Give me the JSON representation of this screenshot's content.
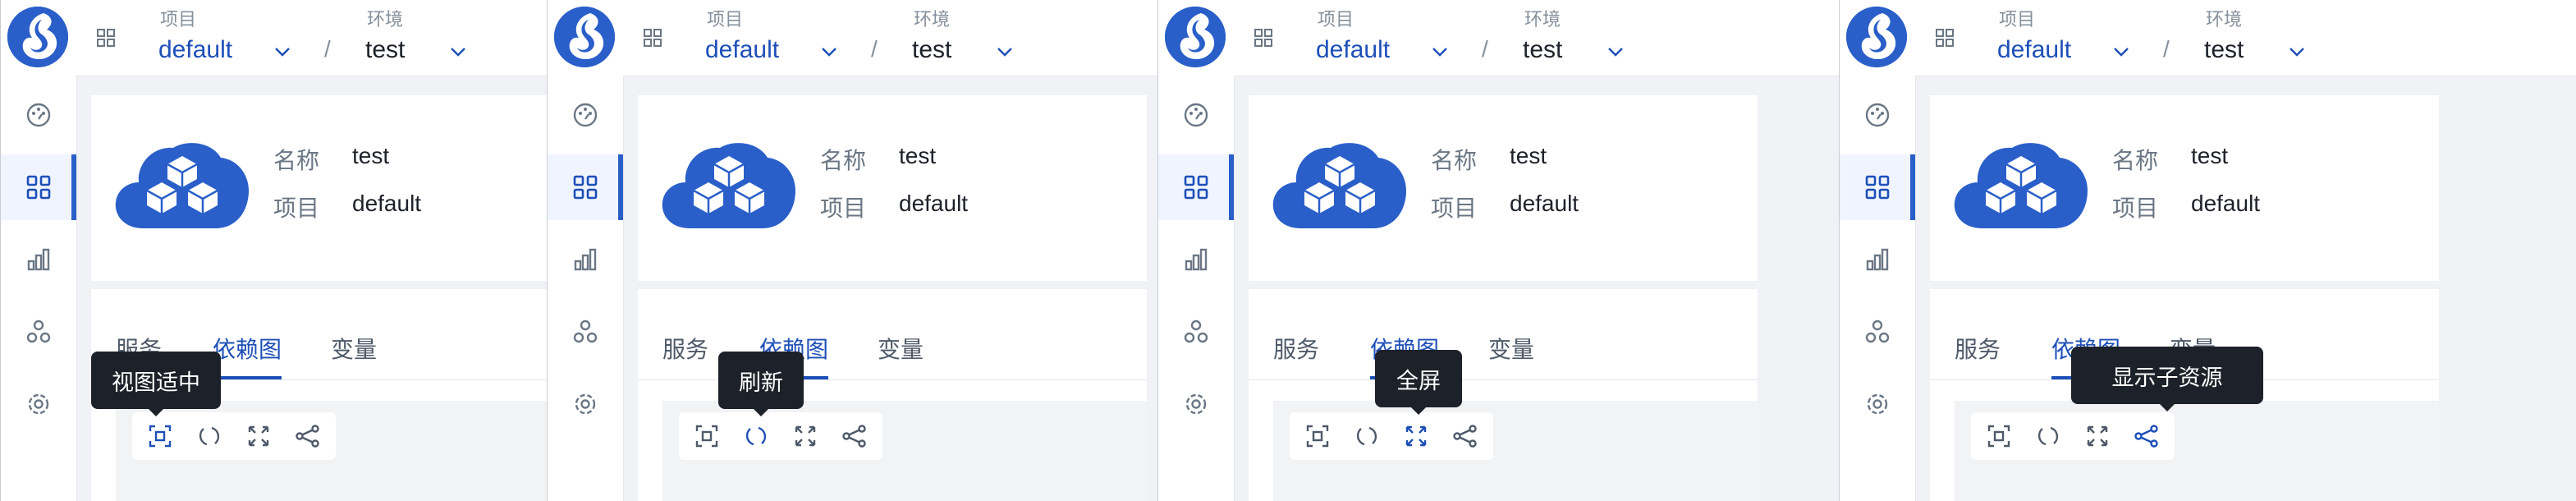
{
  "header": {
    "project_label": "项目",
    "project_value": "default",
    "env_label": "环境",
    "env_value": "test",
    "separator": "/"
  },
  "info": {
    "name_label": "名称",
    "name_value": "test",
    "project_label": "项目",
    "project_value": "default"
  },
  "tabs": [
    "服务",
    "依赖图",
    "变量"
  ],
  "active_tab": "依赖图",
  "toolbar": [
    "fit-view",
    "refresh",
    "fullscreen",
    "show-sub-resources"
  ],
  "tooltips": [
    "视图适中",
    "刷新",
    "全屏",
    "显示子资源"
  ],
  "nav": [
    "dashboard-icon",
    "apps-grid-icon",
    "bar-chart-icon",
    "resources-icon",
    "settings-icon"
  ],
  "colors": {
    "accent": "#1d4fb8",
    "brand": "#2a5fc9",
    "tooltip_bg": "#1d2129"
  }
}
